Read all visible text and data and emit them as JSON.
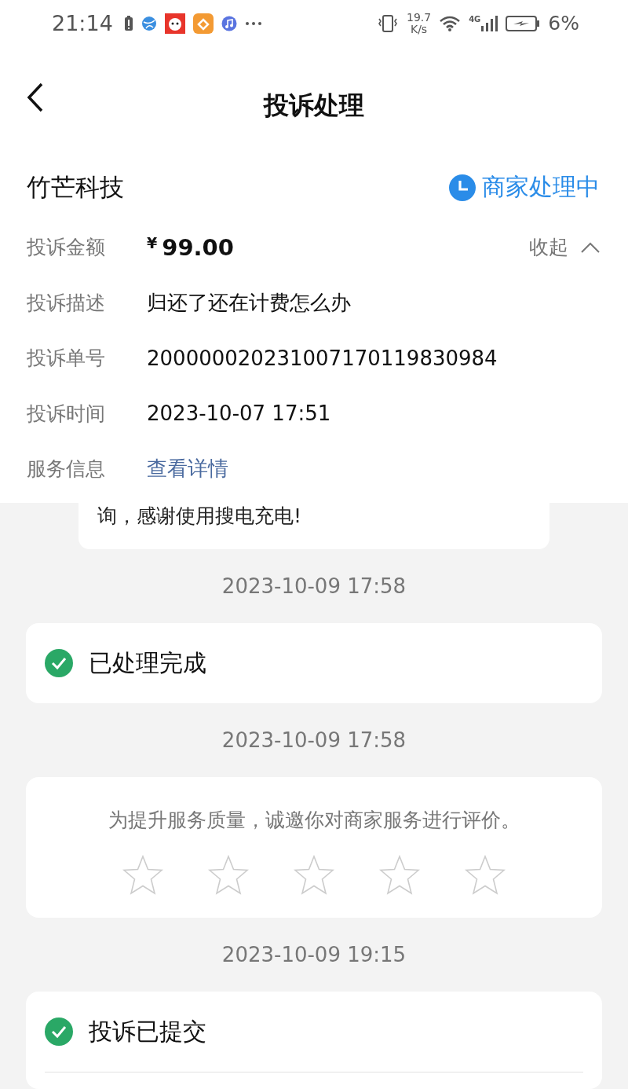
{
  "status_bar": {
    "time": "21:14",
    "speed_value": "19.7",
    "speed_unit": "K/s",
    "network": "4G",
    "battery": "6%"
  },
  "header": {
    "title": "投诉处理"
  },
  "merchant": {
    "name": "竹芒科技",
    "status": "商家处理中"
  },
  "details": {
    "amount_label": "投诉金额",
    "currency": "¥",
    "amount": "99.00",
    "toggle": "收起",
    "expanded": true,
    "rows": [
      {
        "label": "投诉描述",
        "value": "归还了还在计费怎么办",
        "kind": "text"
      },
      {
        "label": "投诉单号",
        "value": "200000020231007170119830984",
        "kind": "text"
      },
      {
        "label": "投诉时间",
        "value": "2023-10-07 17:51",
        "kind": "text"
      },
      {
        "label": "服务信息",
        "value": "查看详情",
        "kind": "link"
      }
    ]
  },
  "timeline": [
    {
      "kind": "message",
      "text": "询，感谢使用搜电充电!"
    },
    {
      "kind": "time",
      "text": "2023-10-09 17:58"
    },
    {
      "kind": "status",
      "text": "已处理完成"
    },
    {
      "kind": "time",
      "text": "2023-10-09 17:58"
    },
    {
      "kind": "rating",
      "text": "为提升服务质量，诚邀你对商家服务进行评价。",
      "stars": 0
    },
    {
      "kind": "time",
      "text": "2023-10-09 19:15"
    },
    {
      "kind": "status",
      "text": "投诉已提交",
      "divider": true
    }
  ]
}
